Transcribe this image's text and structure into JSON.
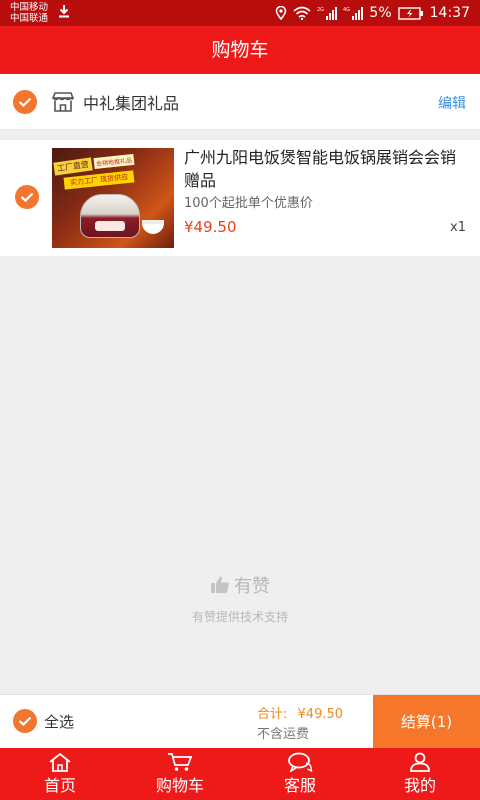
{
  "status_bar": {
    "carrier_1": "中国移动",
    "carrier_2": "中国联通",
    "battery": "5%",
    "time": "14:37",
    "icons": [
      "download-icon",
      "location-icon",
      "wifi-icon",
      "signal-icon",
      "battery-icon"
    ]
  },
  "header": {
    "title": "购物车"
  },
  "shop": {
    "name": "中礼集团礼品",
    "edit_label": "编辑",
    "checked": true,
    "icon": "store-icon"
  },
  "cart_items": [
    {
      "title": "广州九阳电饭煲智能电饭锅展销会会销赠品",
      "subtitle": "100个起批单个优惠价",
      "price": "¥49.50",
      "quantity": "x1",
      "checked": true,
      "image_tags": [
        "工厂直营",
        "会销地推礼品",
        "实力工厂 现货供应"
      ]
    }
  ],
  "branding": {
    "name": "有赞",
    "tagline": "有赞提供技术支持",
    "icon": "thumbs-up-icon"
  },
  "checkout_bar": {
    "select_all_label": "全选",
    "total_label": "合计:",
    "total_value": "¥49.50",
    "shipping_note": "不含运费",
    "checkout_label": "结算(1)"
  },
  "tabs": [
    {
      "label": "首页",
      "icon": "home-icon"
    },
    {
      "label": "购物车",
      "icon": "cart-icon"
    },
    {
      "label": "客服",
      "icon": "chat-icon"
    },
    {
      "label": "我的",
      "icon": "user-icon"
    }
  ],
  "colors": {
    "status_bar": "#b80d0d",
    "header": "#ee1a1a",
    "accent_orange": "#f2762e",
    "price_red": "#e8421f",
    "edit_blue": "#3a8ee6",
    "checkout_button": "#f6772a"
  }
}
